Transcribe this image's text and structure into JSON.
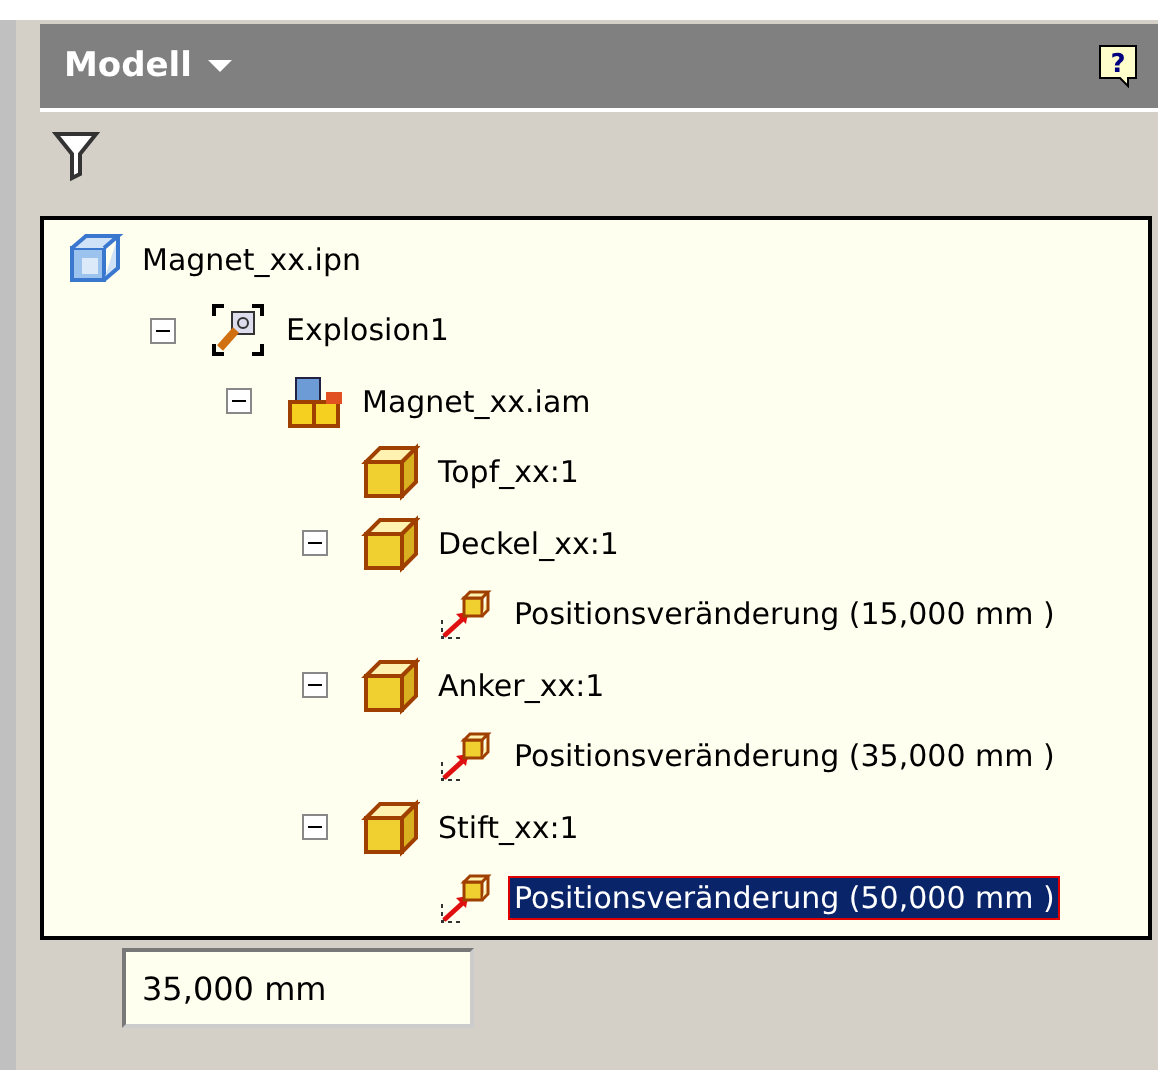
{
  "panel": {
    "title": "Modell",
    "help": "?"
  },
  "tree": [
    {
      "label": "Magnet_xx.ipn",
      "kind": "presentation",
      "selected": false,
      "children": [
        {
          "label": "Explosion1",
          "kind": "explosion",
          "selected": false,
          "expanded": true,
          "children": [
            {
              "label": "Magnet_xx.iam",
              "kind": "assembly",
              "selected": false,
              "expanded": true,
              "children": [
                {
                  "label": "Topf_xx:1",
                  "kind": "part",
                  "selected": false
                },
                {
                  "label": "Deckel_xx:1",
                  "kind": "part",
                  "selected": false,
                  "expanded": true,
                  "children": [
                    {
                      "label": "Positionsveränderung (15,000 mm )",
                      "kind": "tweak",
                      "selected": false
                    }
                  ]
                },
                {
                  "label": "Anker_xx:1",
                  "kind": "part",
                  "selected": false,
                  "expanded": true,
                  "children": [
                    {
                      "label": "Positionsveränderung (35,000 mm )",
                      "kind": "tweak",
                      "selected": false
                    }
                  ]
                },
                {
                  "label": "Stift_xx:1",
                  "kind": "part",
                  "selected": false,
                  "expanded": true,
                  "children": [
                    {
                      "label": "Positionsveränderung (50,000 mm )",
                      "kind": "tweak",
                      "selected": true
                    }
                  ]
                }
              ]
            }
          ]
        }
      ]
    }
  ],
  "value_field": {
    "value": "35,000 mm"
  }
}
